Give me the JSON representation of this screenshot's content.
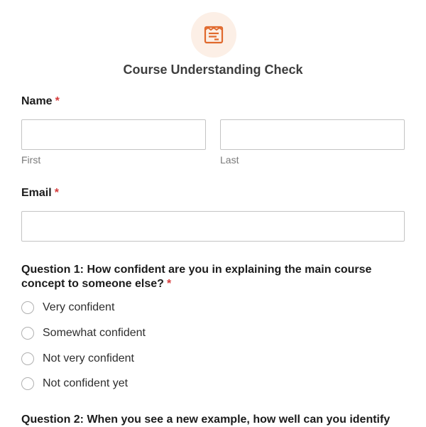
{
  "form": {
    "title": "Course Understanding Check",
    "required_marker": "*",
    "logo_icon": "form-document-icon",
    "accent_color": "#e0692d"
  },
  "name_field": {
    "label": "Name",
    "first_value": "",
    "last_value": "",
    "first_sublabel": "First",
    "last_sublabel": "Last"
  },
  "email_field": {
    "label": "Email",
    "value": ""
  },
  "question1": {
    "text": "Question 1: How confident are you in explaining the main course concept to someone else?",
    "options": [
      "Very confident",
      "Somewhat confident",
      "Not very confident",
      "Not confident yet"
    ]
  },
  "question2": {
    "text": "Question 2: When you see a new example, how well can you identify"
  }
}
